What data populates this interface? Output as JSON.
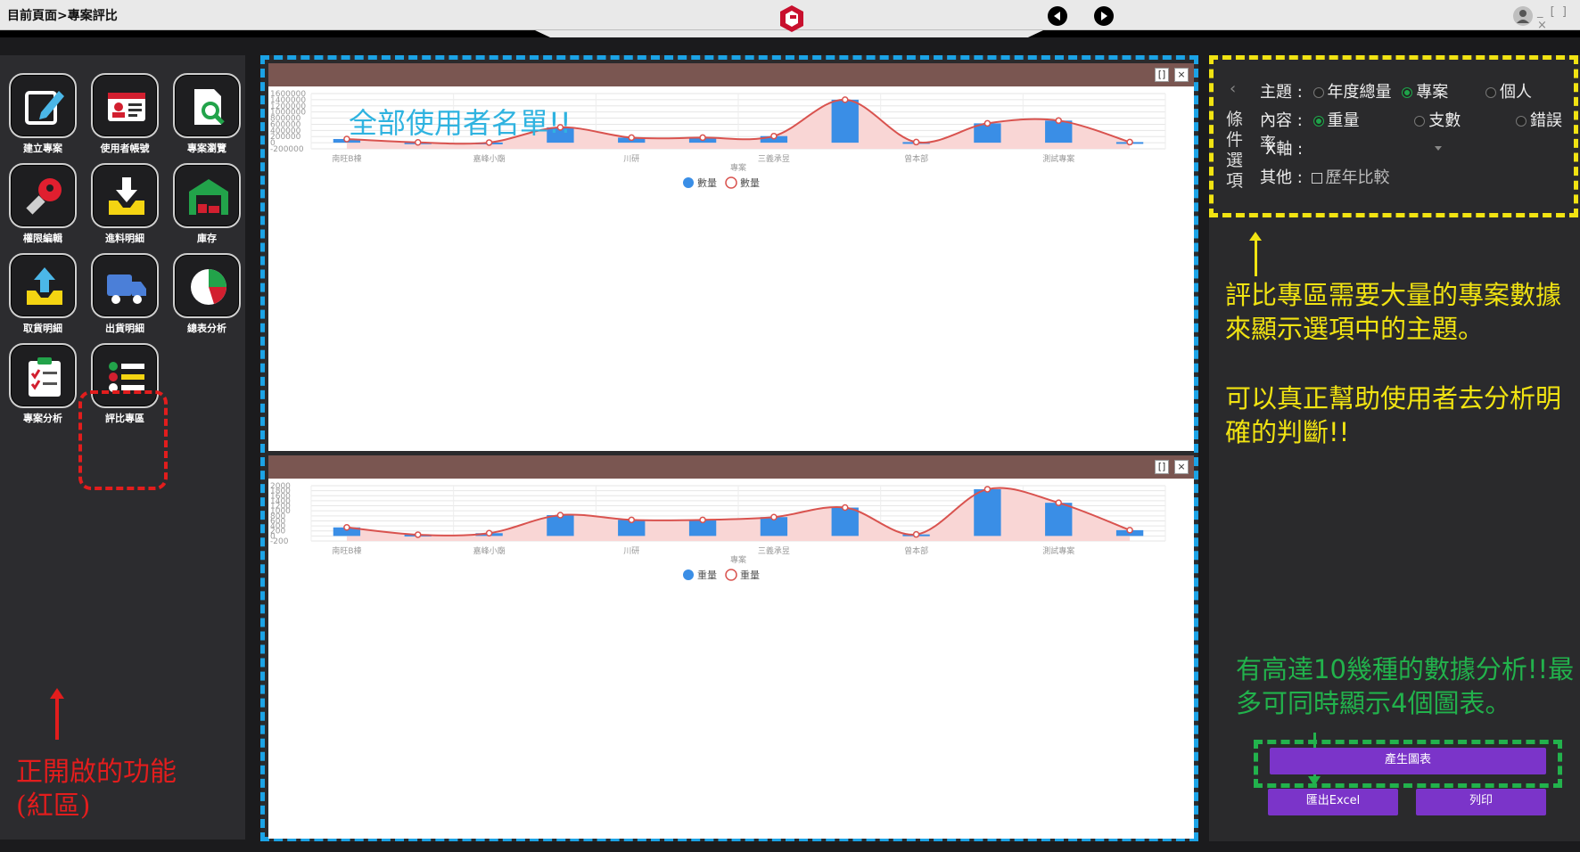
{
  "topbar": {
    "breadcrumb": "目前頁面>專案評比",
    "window_controls": "_ [ ] ×"
  },
  "sidebar": {
    "items": [
      {
        "label": "建立專案",
        "icon": "edit-icon"
      },
      {
        "label": "使用者帳號",
        "icon": "id-card-icon"
      },
      {
        "label": "專案瀏覽",
        "icon": "document-search-icon"
      },
      {
        "label": "權限編輯",
        "icon": "key-icon"
      },
      {
        "label": "進料明細",
        "icon": "download-tray-icon"
      },
      {
        "label": "庫存",
        "icon": "warehouse-icon"
      },
      {
        "label": "取貨明細",
        "icon": "upload-tray-icon"
      },
      {
        "label": "出貨明細",
        "icon": "truck-icon"
      },
      {
        "label": "總表分析",
        "icon": "pie-chart-icon"
      },
      {
        "label": "專案分析",
        "icon": "clipboard-checklist-icon"
      },
      {
        "label": "評比專區",
        "icon": "list-icon"
      }
    ],
    "active_item": "評比專區",
    "annotation": [
      "正開啟的功能",
      "(紅區)"
    ]
  },
  "charts": {
    "chart1_title": "全部使用者名單!!",
    "restore_label": "[]",
    "close_label": "×"
  },
  "chart_data": [
    {
      "type": "bar",
      "title": "全部使用者名單!!",
      "xlabel": "專案",
      "categories": [
        "南旺B棟",
        "",
        "嘉峰小廟",
        "",
        "川研",
        "",
        "三義承昱",
        "",
        "曾本部",
        "",
        "測試專案",
        ""
      ],
      "x_tick_labels": [
        "南旺B棟",
        "嘉峰小廟",
        "川研",
        "三義承昱",
        "曾本部",
        "測試專案"
      ],
      "ylim": [
        -200000,
        1600000
      ],
      "y_ticks": [
        -200000,
        0,
        200000,
        400000,
        600000,
        800000,
        1000000,
        1200000,
        1400000,
        1600000
      ],
      "series": [
        {
          "name": "數量",
          "kind": "bar",
          "values": [
            120000,
            10000,
            5000,
            500000,
            165000,
            165000,
            215000,
            1400000,
            20000,
            630000,
            720000,
            20000
          ]
        },
        {
          "name": "數量",
          "kind": "line",
          "values": [
            120000,
            10000,
            5000,
            500000,
            165000,
            165000,
            215000,
            1400000,
            20000,
            630000,
            720000,
            20000
          ]
        }
      ],
      "legend": "bottom",
      "grid": true
    },
    {
      "type": "bar",
      "xlabel": "專案",
      "categories": [
        "南旺B棟",
        "",
        "嘉峰小廟",
        "",
        "川研",
        "",
        "三義承昱",
        "",
        "曾本部",
        "",
        "測試專案",
        ""
      ],
      "x_tick_labels": [
        "南旺B棟",
        "嘉峰小廟",
        "川研",
        "三義承昱",
        "曾本部",
        "測試專案"
      ],
      "ylim": [
        -200,
        2000
      ],
      "y_ticks": [
        -200,
        0,
        200,
        400,
        600,
        800,
        1000,
        1200,
        1400,
        1600,
        1800,
        2000
      ],
      "series": [
        {
          "name": "重量",
          "kind": "bar",
          "values": [
            340,
            50,
            110,
            830,
            640,
            640,
            750,
            1130,
            60,
            1860,
            1320,
            230
          ]
        },
        {
          "name": "重量",
          "kind": "line",
          "values": [
            340,
            50,
            110,
            830,
            640,
            640,
            750,
            1130,
            60,
            1860,
            1320,
            230
          ]
        }
      ],
      "legend": "bottom",
      "grid": true
    }
  ],
  "filters": {
    "section_label": "條件選項",
    "collapse_icon": "‹",
    "theme": {
      "label": "主題 :",
      "options": [
        "年度總量",
        "專案",
        "個人"
      ],
      "selected": "專案"
    },
    "content": {
      "label": "內容 :",
      "options": [
        "重量",
        "支數",
        "錯誤率"
      ],
      "selected": "重量"
    },
    "xaxis": {
      "label": "X軸 :",
      "value": ""
    },
    "other": {
      "label": "其他 :",
      "checkbox_label": "歷年比較",
      "checked": false
    }
  },
  "annotations": {
    "yellow_1": "評比專區需要大量的專案數據來顯示選項中的主題。",
    "yellow_2": "可以真正幫助使用者去分析明確的判斷!!",
    "green": "有高達10幾種的數據分析!!最多可同時顯示4個圖表。"
  },
  "buttons": {
    "generate": "產生圖表",
    "export_excel": "匯出Excel",
    "print": "列印"
  },
  "colors": {
    "bar": "#3a8ee6",
    "line": "#d9534f",
    "area": "#f9d6d5",
    "panel_header": "#7a5651",
    "red_annotation": "#e21d1d",
    "yellow_annotation": "#f1e312",
    "green_annotation": "#22b24c",
    "blue_frame": "#1ba3e6",
    "button": "#7b34c9"
  }
}
